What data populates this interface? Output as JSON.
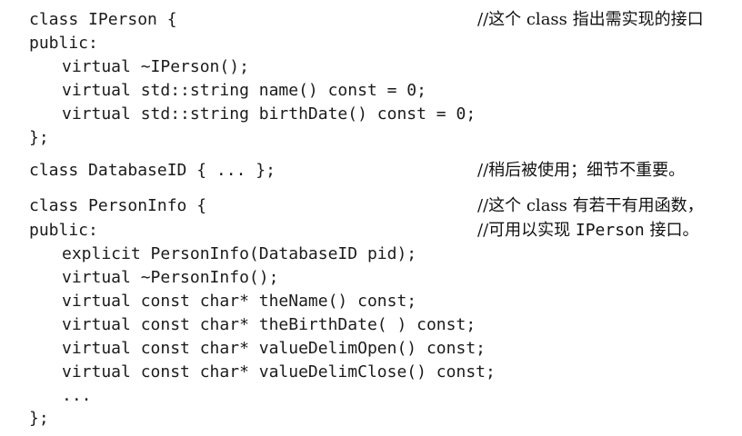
{
  "code": {
    "iperson": {
      "class_line": "class IPerson {",
      "public": "public:",
      "destructor": "virtual ~IPerson();",
      "name_method": "virtual std::string name() const = 0;",
      "birth_method": "virtual std::string birthDate() const = 0;",
      "close": "};"
    },
    "database_id": {
      "class_line": "class DatabaseID { ... };"
    },
    "person_info": {
      "class_line": "class PersonInfo {",
      "public": "public:",
      "ctor": "explicit PersonInfo(DatabaseID pid);",
      "dtor": "virtual ~PersonInfo();",
      "the_name": "virtual const char* theName() const;",
      "the_birth": "virtual const char* theBirthDate( ) const;",
      "delim_open": "virtual const char* valueDelimOpen() const;",
      "delim_close": "virtual const char* valueDelimClose() const;",
      "ellipsis": "...",
      "close": "};"
    }
  },
  "comments": {
    "iperson": "//这个 class 指出需实现的接口",
    "database_id": "//稍后被使用；细节不重要。",
    "person_info_1": "//这个 class 有若干有用函数，",
    "person_info_2_prefix": "//可用以实现 ",
    "person_info_2_code": "IPerson",
    "person_info_2_suffix": " 接口。"
  }
}
